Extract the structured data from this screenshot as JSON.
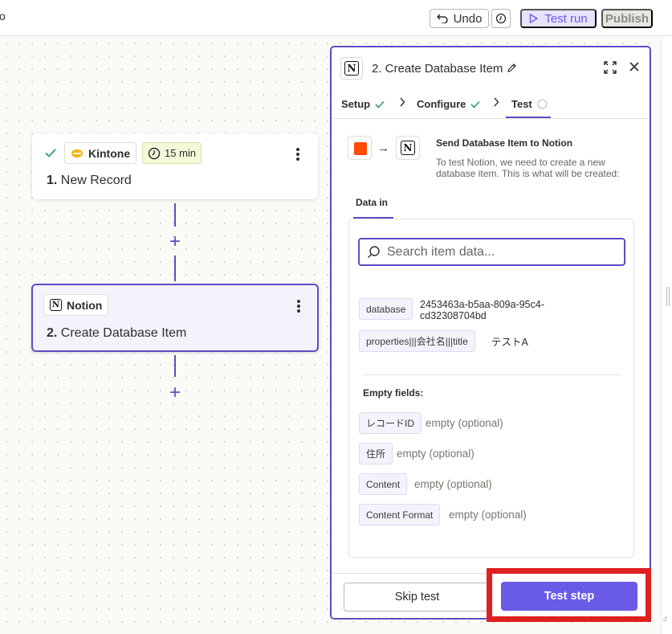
{
  "topbar": {
    "left_fragment": "o",
    "undo_label": "Undo",
    "test_run_label": "Test run",
    "publish_label": "Publish"
  },
  "canvas": {
    "step1": {
      "app_name": "Kintone",
      "schedule": "15 min",
      "number": "1.",
      "title": "New Record"
    },
    "step2": {
      "app_name": "Notion",
      "number": "2.",
      "title": "Create Database Item"
    },
    "plus_symbol": "+",
    "edge_fragment": "d"
  },
  "panel": {
    "title": "2. Create Database Item",
    "steps": [
      {
        "label": "Setup"
      },
      {
        "label": "Configure"
      },
      {
        "label": "Test"
      }
    ],
    "action_title": "Send Database Item to Notion",
    "action_description": "To test Notion, we need to create a new database item. This is what will be created:",
    "data_in_tab": "Data in",
    "search_placeholder": "Search item data...",
    "fields": [
      {
        "key": "database",
        "value": "2453463a-b5aa-809a-95c4-cd32308704bd"
      },
      {
        "key": "properties|||会社名|||title",
        "value": "テストA"
      }
    ],
    "empty_fields_heading": "Empty fields:",
    "empty_fields": [
      {
        "key": "レコードID",
        "value": "empty (optional)"
      },
      {
        "key": "住所",
        "value": "empty (optional)"
      },
      {
        "key": "Content",
        "value": "empty (optional)"
      },
      {
        "key": "Content Format",
        "value": "empty (optional)"
      }
    ],
    "skip_test_label": "Skip test",
    "test_step_label": "Test step"
  },
  "colors": {
    "accent": "#695be8",
    "accent_dark": "#5a4ec4",
    "zapier_orange": "#ff4a00",
    "success_green": "#2e9e5b",
    "highlight_red": "#e02020"
  }
}
